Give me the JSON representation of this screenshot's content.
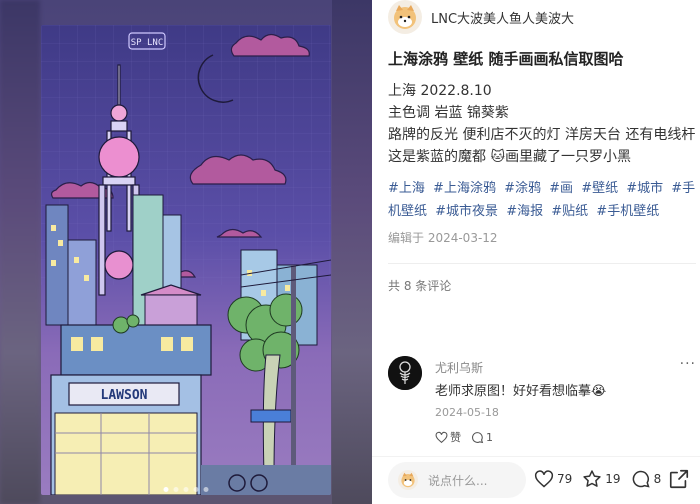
{
  "author": {
    "name": "LNC大波美人鱼人美波大"
  },
  "post": {
    "title": "上海涂鸦 壁纸 随手画画私信取图哈",
    "lines": [
      "上海 2022.8.10",
      "主色调 岩蓝 锦葵紫",
      "路牌的反光 便利店不灭的灯 洋房天台 还有电线杆 这是紫蓝的魔都 ",
      "画里藏了一只罗小黑"
    ],
    "emoji": "🐱",
    "tags": [
      "#上海",
      "#上海涂鸦",
      "#涂鸦",
      "#画",
      "#壁纸",
      "#城市",
      "#手机壁纸",
      "#城市夜景",
      "#海报",
      "#贴纸",
      "#手机壁纸"
    ],
    "edited": "编辑于 2024-03-12",
    "comment_count": "共 8 条评论"
  },
  "artwork": {
    "store_sign": "LAWSON",
    "sign_text": "SP LNC"
  },
  "comment": {
    "name": "尤利乌斯",
    "text": "老师求原图！好好看想临摹",
    "emoji": "😭",
    "date": "2024-05-18",
    "like_label": "赞",
    "reply_count": "1",
    "more": "···"
  },
  "bottom_bar": {
    "placeholder": "说点什么...",
    "likes": "79",
    "favorites": "19",
    "comments": "8"
  },
  "carousel": {
    "count": 5,
    "active": 0
  },
  "colors": {
    "tag": "#3a5b94",
    "accent": "#ff2442"
  }
}
